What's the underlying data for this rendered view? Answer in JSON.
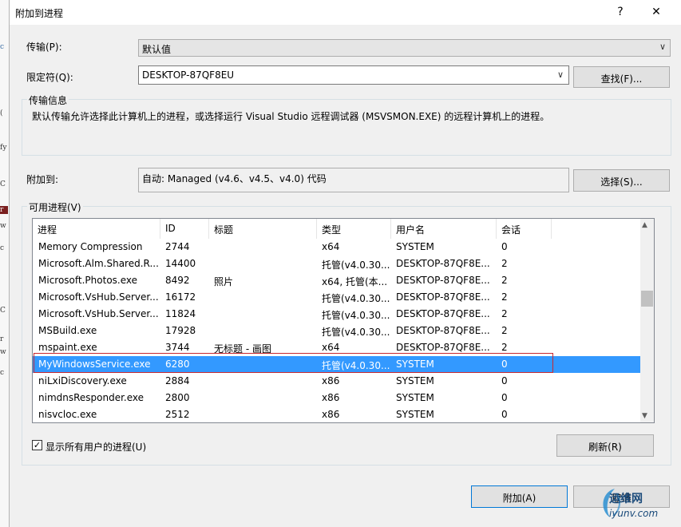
{
  "dialog": {
    "title": "附加到进程",
    "help_label": "?",
    "close_label": "✕"
  },
  "transport": {
    "label": "传输(P):",
    "value": "默认值"
  },
  "qualifier": {
    "label": "限定符(Q):",
    "value": "DESKTOP-87QF8EU",
    "find_button": "查找(F)..."
  },
  "transport_info": {
    "caption": "传输信息",
    "text": "默认传输允许选择此计算机上的进程，或选择运行 Visual Studio 远程调试器 (MSVSMON.EXE) 的远程计算机上的进程。"
  },
  "attach_to": {
    "label": "附加到:",
    "value": "自动: Managed (v4.6、v4.5、v4.0) 代码",
    "select_button": "选择(S)..."
  },
  "processes": {
    "caption": "可用进程(V)",
    "columns": [
      "进程",
      "ID",
      "标题",
      "类型",
      "用户名",
      "会话"
    ],
    "rows": [
      {
        "name": "Memory Compression",
        "id": "2744",
        "title": "",
        "type": "x64",
        "user": "SYSTEM",
        "session": "0"
      },
      {
        "name": "Microsoft.Alm.Shared.R...",
        "id": "14400",
        "title": "",
        "type": "托管(v4.0.30...",
        "user": "DESKTOP-87QF8E...",
        "session": "2"
      },
      {
        "name": "Microsoft.Photos.exe",
        "id": "8492",
        "title": "照片",
        "type": "x64, 托管(本...",
        "user": "DESKTOP-87QF8E...",
        "session": "2"
      },
      {
        "name": "Microsoft.VsHub.Server...",
        "id": "16172",
        "title": "",
        "type": "托管(v4.0.30...",
        "user": "DESKTOP-87QF8E...",
        "session": "2"
      },
      {
        "name": "Microsoft.VsHub.Server...",
        "id": "11824",
        "title": "",
        "type": "托管(v4.0.30...",
        "user": "DESKTOP-87QF8E...",
        "session": "2"
      },
      {
        "name": "MSBuild.exe",
        "id": "17928",
        "title": "",
        "type": "托管(v4.0.30...",
        "user": "DESKTOP-87QF8E...",
        "session": "2"
      },
      {
        "name": "mspaint.exe",
        "id": "3744",
        "title": "无标题 - 画图",
        "type": "x64",
        "user": "DESKTOP-87QF8E...",
        "session": "2"
      },
      {
        "name": "MyWindowsService.exe",
        "id": "6280",
        "title": "",
        "type": "托管(v4.0.30...",
        "user": "SYSTEM",
        "session": "0"
      },
      {
        "name": "niLxiDiscovery.exe",
        "id": "2884",
        "title": "",
        "type": "x86",
        "user": "SYSTEM",
        "session": "0"
      },
      {
        "name": "nimdnsResponder.exe",
        "id": "2800",
        "title": "",
        "type": "x86",
        "user": "SYSTEM",
        "session": "0"
      },
      {
        "name": "nisvcloc.exe",
        "id": "2512",
        "title": "",
        "type": "x86",
        "user": "SYSTEM",
        "session": "0"
      }
    ],
    "selected_index": 7
  },
  "show_all_users": {
    "label": "显示所有用户的进程(U)",
    "checked": true
  },
  "refresh_button": "刷新(R)",
  "attach_button": "附加(A)",
  "cancel_button": "取消",
  "watermark": {
    "line1": "运维网",
    "line2": "iyunv.com"
  },
  "colors": {
    "selection": "#3399ff",
    "highlight_frame": "#c8282f",
    "dialog_bg": "#f0f0f0"
  }
}
